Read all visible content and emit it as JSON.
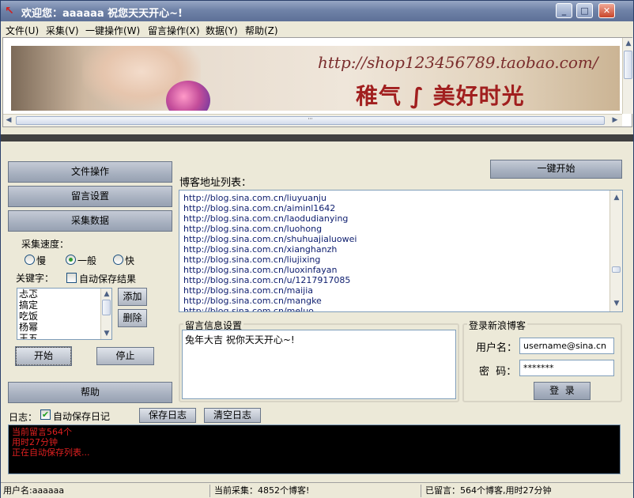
{
  "window": {
    "title": "欢迎您：aaaaaa 祝您天天开心~!",
    "controls": [
      "_",
      "□",
      "✕"
    ]
  },
  "menu": [
    "文件(U)",
    "采集(V)",
    "一键操作(W)",
    "留言操作(X)",
    "数据(Y)",
    "帮助(Z)"
  ],
  "banner": {
    "url": "http://shop123456789.taobao.com/",
    "slogan": "稚气 ∫ 美好时光",
    "scroll_grip": "'''"
  },
  "sidebar": {
    "buttons": [
      "文件操作",
      "留言设置",
      "采集数据"
    ],
    "help_button": "帮助",
    "speed_label": "采集速度：",
    "speed_options": [
      {
        "label": "慢",
        "checked": false
      },
      {
        "label": "一般",
        "checked": true
      },
      {
        "label": "快",
        "checked": false
      }
    ],
    "keyword_label": "关键字：",
    "autosave_results_label": "自动保存结果",
    "autosave_results_checked": false,
    "keywords": [
      "忐忑",
      "搞定",
      "吃饭",
      "杨幂",
      "王五"
    ],
    "add_button": "添加",
    "delete_button": "删除",
    "start_button": "开始",
    "stop_button": "停止"
  },
  "main": {
    "one_click_button": "一键开始",
    "blog_list_label": "博客地址列表：",
    "blog_urls": [
      "http://blog.sina.com.cn/liuyuanju",
      "http://blog.sina.com.cn/aiminl1642",
      "http://blog.sina.com.cn/laodudianying",
      "http://blog.sina.com.cn/luohong",
      "http://blog.sina.com.cn/shuhuajialuowei",
      "http://blog.sina.com.cn/xianghanzh",
      "http://blog.sina.com.cn/liujixing",
      "http://blog.sina.com.cn/luoxinfayan",
      "http://blog.sina.com.cn/u/1217917085",
      "http://blog.sina.com.cn/maijia",
      "http://blog.sina.com.cn/mangke",
      "http://blog.sina.com.cn/meluo"
    ],
    "message_group_title": "留言信息设置",
    "message_text": "兔年大吉 祝你天天开心~!",
    "login_group_title": "登录新浪博客",
    "username_label": "用户名：",
    "username_value": "username@sina.cn",
    "password_label": "密  码：",
    "password_value": "*******",
    "login_button": "登  录"
  },
  "log": {
    "label": "日志：",
    "autosave_label": "自动保存日记",
    "autosave_checked": true,
    "save_button": "保存日志",
    "clear_button": "清空日志",
    "lines": [
      "当前留言564个",
      "用时27分钟",
      "正在自动保存列表..."
    ]
  },
  "status": {
    "user": "用户名:aaaaaa",
    "collect": "当前采集：4852个博客!",
    "posted": "已留言：564个博客,用时27分钟"
  },
  "colors": {
    "log_text": "#e02020",
    "url_text": "#102070",
    "banner_url": "#7a2d2d",
    "banner_slogan": "#a11f1f"
  }
}
